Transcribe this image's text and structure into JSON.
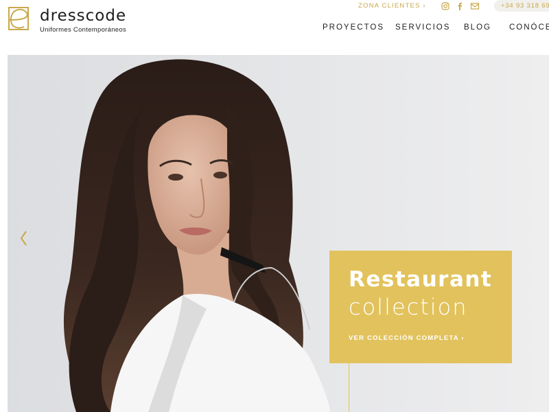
{
  "brand": {
    "name": "dresscode",
    "tagline": "Uniformes Contemporáneos",
    "accent_color": "#c8a84b"
  },
  "topbar": {
    "client_area": "ZONA CLIENTES ›",
    "social_icons": [
      "instagram-icon",
      "facebook-icon",
      "mail-icon"
    ],
    "phone": "+34 93 318 69"
  },
  "nav": {
    "items": [
      "PROYECTOS",
      "SERVICIOS",
      "BLOG",
      "CONÓCE"
    ]
  },
  "hero": {
    "background_color": "#e4e5e7",
    "prev_icon": "chevron-left-icon",
    "promo": {
      "title_line1": "Restaurant",
      "title_line2": "collection",
      "cta": "VER COLECCIÓN COMPLETA ›",
      "box_color": "#e2c25c"
    }
  }
}
